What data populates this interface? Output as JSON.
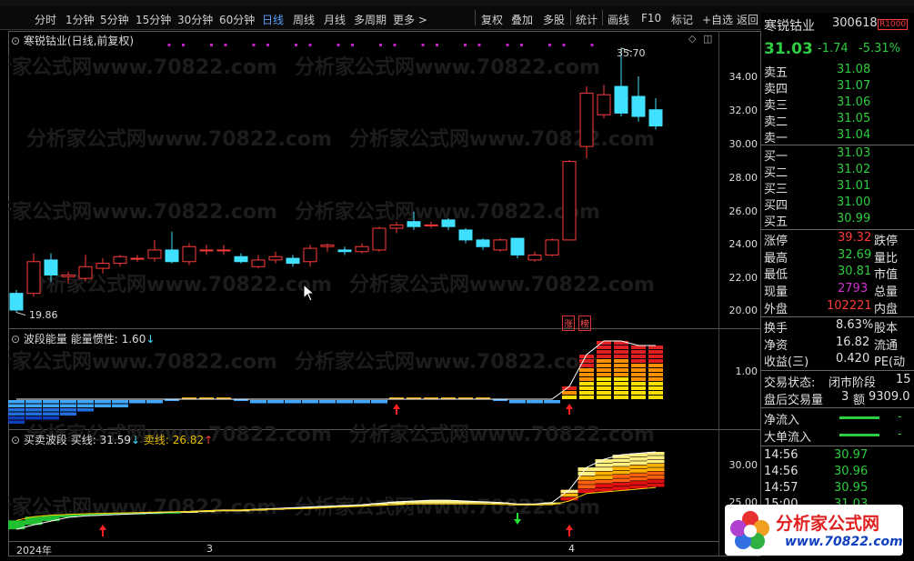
{
  "toolbar": {
    "items": [
      "分时",
      "1分钟",
      "5分钟",
      "15分钟",
      "30分钟",
      "60分钟",
      "日线",
      "周线",
      "月线",
      "多周期",
      "更多 >"
    ],
    "active": "日线",
    "right_items": [
      "复权",
      "叠加",
      "多股",
      "统计",
      "画线",
      "F10",
      "标记",
      "+自选",
      "返回"
    ]
  },
  "chart": {
    "title": "寒锐钴业(日线,前复权)",
    "high_label": "35.70",
    "low_label": "19.86",
    "y_ticks": [
      "34.00",
      "32.00",
      "30.00",
      "28.00",
      "26.00",
      "24.00",
      "22.00",
      "20.00"
    ],
    "badges": [
      "涨",
      "榜"
    ],
    "watermark": "分析家公式网www.70822.com"
  },
  "pane2": {
    "title": "波段能量",
    "label": "能量惯性:",
    "value": "1.60",
    "arrow": "↓",
    "y_tick": "1.00"
  },
  "pane3": {
    "title": "买卖波段",
    "buy_label": "买线:",
    "buy_value": "31.59",
    "buy_arrow": "↓",
    "sell_label": "卖线:",
    "sell_value": "26.82",
    "sell_arrow": "↑",
    "y_ticks": [
      "30.00",
      "25.00"
    ]
  },
  "xaxis": [
    "2024年",
    "3",
    "4"
  ],
  "quote": {
    "name": "寒锐钴业",
    "code": "300618",
    "price": "31.03",
    "change": "-1.74",
    "pct": "-5.31%",
    "sells": [
      {
        "label": "卖五",
        "price": "31.08"
      },
      {
        "label": "卖四",
        "price": "31.07"
      },
      {
        "label": "卖三",
        "price": "31.06"
      },
      {
        "label": "卖二",
        "price": "31.05"
      },
      {
        "label": "卖一",
        "price": "31.04"
      }
    ],
    "buys": [
      {
        "label": "买一",
        "price": "31.03"
      },
      {
        "label": "买二",
        "price": "31.02"
      },
      {
        "label": "买三",
        "price": "31.01"
      },
      {
        "label": "买四",
        "price": "31.00"
      },
      {
        "label": "买五",
        "price": "30.99"
      }
    ],
    "stats": [
      {
        "label": "涨停",
        "value": "39.32",
        "label2": "跌停"
      },
      {
        "label": "最高",
        "value": "32.69",
        "label2": "量比"
      },
      {
        "label": "最低",
        "value": "30.81",
        "label2": "市值"
      },
      {
        "label": "现量",
        "value": "2793",
        "label2": "总量"
      },
      {
        "label": "外盘",
        "value": "102221",
        "label2": "内盘"
      },
      {
        "label": "换手",
        "value": "8.63%",
        "label2": "股本"
      },
      {
        "label": "净资",
        "value": "16.82",
        "label2": "流通"
      },
      {
        "label": "收益(三)",
        "value": "0.420",
        "label2": "PE(动"
      }
    ],
    "trade_state_label": "交易状态:",
    "trade_state": "闭市阶段",
    "trade_state_num": "15",
    "after_hours": "盘后交易量",
    "after_hours_val": "3",
    "after_hours_amt_label": "额",
    "after_hours_amt": "9309.0",
    "flows": [
      {
        "label": "净流入",
        "value": "-"
      },
      {
        "label": "大单流入",
        "value": "-"
      }
    ],
    "ticks": [
      {
        "time": "14:56",
        "price": "30.97"
      },
      {
        "time": "14:56",
        "price": "30.96"
      },
      {
        "time": "14:57",
        "price": "30.95"
      },
      {
        "time": "15:00",
        "price": "31.03"
      }
    ]
  },
  "logo": {
    "text": "分析家公式网",
    "url": "www.70822.com"
  },
  "chart_data": {
    "type": "candlestick",
    "ylim": [
      19.0,
      36.5
    ],
    "candles": [
      [
        21.0,
        20.0,
        21.2,
        19.86
      ],
      [
        21.0,
        22.9,
        23.4,
        20.8
      ],
      [
        23.0,
        22.1,
        23.4,
        21.7
      ],
      [
        22.0,
        22.1,
        22.3,
        21.6
      ],
      [
        21.9,
        22.6,
        23.3,
        21.7
      ],
      [
        22.5,
        22.8,
        23.1,
        22.2
      ],
      [
        22.8,
        23.2,
        23.3,
        22.6
      ],
      [
        23.1,
        23.1,
        23.3,
        22.9
      ],
      [
        23.1,
        23.6,
        24.2,
        22.9
      ],
      [
        23.6,
        22.9,
        24.7,
        22.8
      ],
      [
        22.9,
        23.8,
        24.0,
        22.7
      ],
      [
        23.6,
        23.6,
        23.9,
        23.3
      ],
      [
        23.6,
        23.6,
        23.9,
        23.3
      ],
      [
        23.2,
        22.9,
        23.4,
        22.8
      ],
      [
        22.6,
        23.0,
        23.3,
        22.5
      ],
      [
        23.0,
        23.2,
        23.5,
        22.8
      ],
      [
        23.1,
        22.8,
        23.3,
        22.6
      ],
      [
        22.9,
        23.7,
        23.9,
        22.6
      ],
      [
        23.8,
        23.9,
        24.0,
        23.5
      ],
      [
        23.6,
        23.5,
        23.8,
        23.3
      ],
      [
        23.5,
        23.8,
        24.0,
        23.4
      ],
      [
        23.6,
        24.9,
        25.0,
        23.5
      ],
      [
        24.9,
        25.1,
        25.3,
        24.6
      ],
      [
        25.3,
        25.0,
        25.9,
        24.8
      ],
      [
        25.1,
        25.1,
        25.3,
        24.9
      ],
      [
        25.4,
        25.0,
        25.5,
        24.8
      ],
      [
        24.8,
        24.2,
        24.9,
        24.0
      ],
      [
        24.2,
        23.8,
        24.3,
        23.6
      ],
      [
        23.6,
        24.2,
        24.3,
        23.5
      ],
      [
        24.3,
        23.3,
        24.3,
        23.1
      ],
      [
        23.0,
        23.3,
        23.5,
        22.9
      ],
      [
        23.3,
        24.2,
        24.3,
        23.2
      ],
      [
        24.2,
        28.9,
        29.0,
        24.2
      ],
      [
        29.8,
        33.0,
        33.4,
        29.1
      ],
      [
        31.7,
        32.9,
        33.5,
        31.5
      ],
      [
        33.4,
        31.8,
        35.7,
        31.6
      ],
      [
        32.8,
        31.6,
        34.0,
        31.3
      ],
      [
        32.0,
        31.03,
        32.69,
        30.81
      ]
    ],
    "energy": [
      -0.95,
      -0.85,
      -0.75,
      -0.62,
      -0.5,
      -0.38,
      -0.25,
      -0.12,
      -0.05,
      0.0,
      0.02,
      0.02,
      0.02,
      0.0,
      -0.02,
      -0.02,
      -0.05,
      -0.08,
      -0.1,
      -0.1,
      -0.06,
      -0.02,
      0.03,
      0.08,
      0.1,
      0.08,
      0.05,
      0.03,
      0.0,
      -0.02,
      -0.03,
      -0.03,
      0.35,
      1.25,
      1.6,
      1.6,
      1.55,
      1.45
    ],
    "buy_line": [
      21.2,
      21.8,
      22.3,
      22.8,
      23.0,
      23.1,
      23.2,
      23.3,
      23.4,
      23.5,
      23.6,
      23.7,
      23.8,
      23.8,
      23.9,
      24.0,
      24.1,
      24.2,
      24.3,
      24.4,
      24.5,
      24.7,
      24.9,
      25.0,
      25.1,
      25.1,
      25.0,
      24.9,
      24.8,
      24.6,
      24.6,
      24.8,
      26.5,
      29.5,
      30.6,
      31.2,
      31.4,
      31.59
    ],
    "sell_line": [
      22.4,
      22.9,
      23.1,
      23.2,
      23.3,
      23.35,
      23.4,
      23.45,
      23.5,
      23.55,
      23.6,
      23.7,
      23.75,
      23.8,
      23.85,
      23.9,
      23.95,
      24.0,
      24.1,
      24.2,
      24.3,
      24.4,
      24.5,
      24.6,
      24.6,
      24.6,
      24.6,
      24.6,
      24.55,
      24.5,
      24.5,
      24.5,
      25.0,
      26.0,
      26.2,
      26.4,
      26.6,
      26.82
    ]
  }
}
